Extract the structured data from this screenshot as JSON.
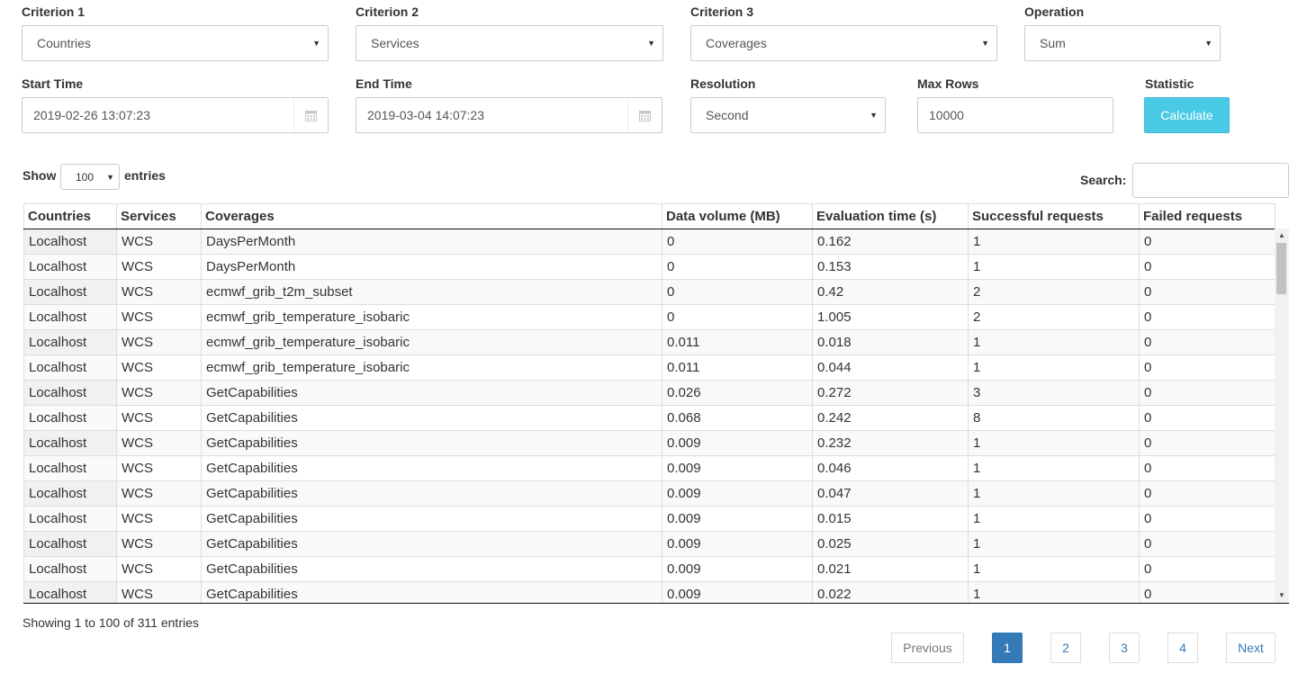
{
  "filters": {
    "criterion1": {
      "label": "Criterion 1",
      "value": "Countries"
    },
    "criterion2": {
      "label": "Criterion 2",
      "value": "Services"
    },
    "criterion3": {
      "label": "Criterion 3",
      "value": "Coverages"
    },
    "operation": {
      "label": "Operation",
      "value": "Sum"
    },
    "start_time": {
      "label": "Start Time",
      "value": "2019-02-26 13:07:23"
    },
    "end_time": {
      "label": "End Time",
      "value": "2019-03-04 14:07:23"
    },
    "resolution": {
      "label": "Resolution",
      "value": "Second"
    },
    "max_rows": {
      "label": "Max Rows",
      "value": "10000"
    },
    "statistic": {
      "label": "Statistic",
      "button": "Calculate"
    }
  },
  "table_controls": {
    "show": "Show",
    "entries_value": "100",
    "entries": "entries",
    "search_label": "Search:",
    "search_value": ""
  },
  "table": {
    "columns": [
      "Countries",
      "Services",
      "Coverages",
      "Data volume (MB)",
      "Evaluation time (s)",
      "Successful requests",
      "Failed requests"
    ],
    "rows": [
      [
        "Localhost",
        "WCS",
        "DaysPerMonth",
        "0",
        "0.162",
        "1",
        "0"
      ],
      [
        "Localhost",
        "WCS",
        "DaysPerMonth",
        "0",
        "0.153",
        "1",
        "0"
      ],
      [
        "Localhost",
        "WCS",
        "ecmwf_grib_t2m_subset",
        "0",
        "0.42",
        "2",
        "0"
      ],
      [
        "Localhost",
        "WCS",
        "ecmwf_grib_temperature_isobaric",
        "0",
        "1.005",
        "2",
        "0"
      ],
      [
        "Localhost",
        "WCS",
        "ecmwf_grib_temperature_isobaric",
        "0.011",
        "0.018",
        "1",
        "0"
      ],
      [
        "Localhost",
        "WCS",
        "ecmwf_grib_temperature_isobaric",
        "0.011",
        "0.044",
        "1",
        "0"
      ],
      [
        "Localhost",
        "WCS",
        "GetCapabilities",
        "0.026",
        "0.272",
        "3",
        "0"
      ],
      [
        "Localhost",
        "WCS",
        "GetCapabilities",
        "0.068",
        "0.242",
        "8",
        "0"
      ],
      [
        "Localhost",
        "WCS",
        "GetCapabilities",
        "0.009",
        "0.232",
        "1",
        "0"
      ],
      [
        "Localhost",
        "WCS",
        "GetCapabilities",
        "0.009",
        "0.046",
        "1",
        "0"
      ],
      [
        "Localhost",
        "WCS",
        "GetCapabilities",
        "0.009",
        "0.047",
        "1",
        "0"
      ],
      [
        "Localhost",
        "WCS",
        "GetCapabilities",
        "0.009",
        "0.015",
        "1",
        "0"
      ],
      [
        "Localhost",
        "WCS",
        "GetCapabilities",
        "0.009",
        "0.025",
        "1",
        "0"
      ],
      [
        "Localhost",
        "WCS",
        "GetCapabilities",
        "0.009",
        "0.021",
        "1",
        "0"
      ],
      [
        "Localhost",
        "WCS",
        "GetCapabilities",
        "0.009",
        "0.022",
        "1",
        "0"
      ]
    ]
  },
  "info": "Showing 1 to 100 of 311 entries",
  "pagination": {
    "previous": "Previous",
    "pages": [
      "1",
      "2",
      "3",
      "4"
    ],
    "next": "Next",
    "active": "1"
  },
  "colors": {
    "primary": "#337ab7",
    "info_button": "#49cbe5"
  }
}
